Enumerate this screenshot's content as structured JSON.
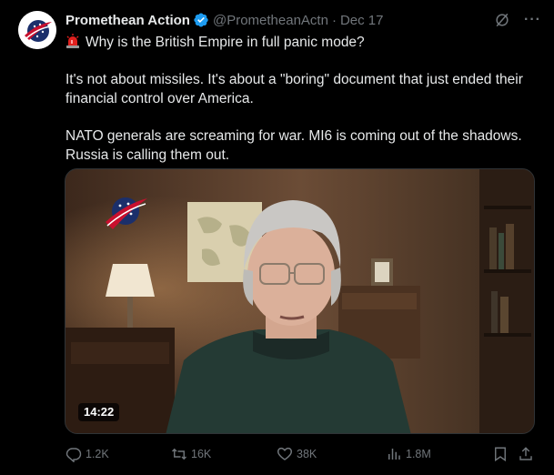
{
  "author": {
    "name": "Promethean Action",
    "handle": "@PrometheanActn",
    "separator": "·",
    "date": "Dec 17"
  },
  "tweet": {
    "line1": "Why is the British Empire in full panic mode?",
    "paragraph2": "It's not about missiles. It's about a \"boring\" document that just ended their financial control over America.",
    "paragraph3": "NATO generals are screaming for war. MI6 is coming out of the shadows. Russia is calling them out."
  },
  "media": {
    "duration": "14:22"
  },
  "actions": {
    "replies": "1.2K",
    "reposts": "16K",
    "likes": "38K",
    "views": "1.8M"
  },
  "icons": {
    "verified": "verified-badge-icon",
    "grok": "grok-icon",
    "more": "more-icon",
    "siren": "siren-emoji-icon",
    "reply": "reply-icon",
    "repost": "repost-icon",
    "like": "heart-icon",
    "views": "views-icon",
    "bookmark": "bookmark-icon",
    "share": "share-icon"
  },
  "colors": {
    "background": "#000000",
    "text": "#e7e9ea",
    "muted": "#71767b",
    "verified": "#1d9bf0"
  }
}
